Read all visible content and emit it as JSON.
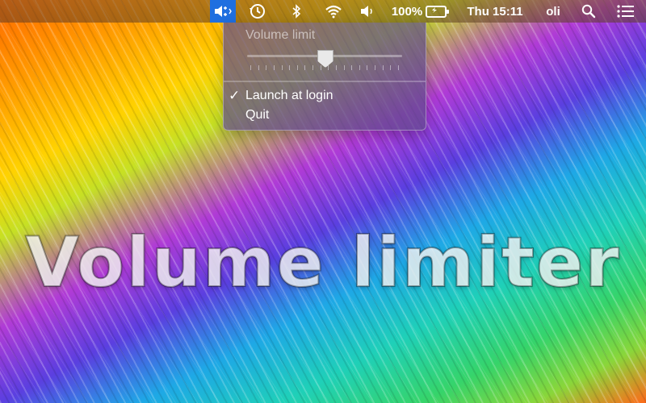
{
  "menubar": {
    "battery_percent": "100%",
    "datetime": "Thu 15:11",
    "user": "oli",
    "icons": [
      "volume-limiter-icon",
      "time-machine-icon",
      "bluetooth-icon",
      "wifi-icon",
      "volume-icon",
      "battery-icon",
      "search-icon",
      "notification-center-icon"
    ]
  },
  "dropdown": {
    "section_label": "Volume limit",
    "slider_value_fraction": 0.5,
    "items": [
      {
        "label": "Launch at login",
        "checked": true
      },
      {
        "label": "Quit",
        "checked": false
      }
    ]
  },
  "hero_text": "Volume limiter",
  "colors": {
    "menubar_active": "#1f6fe0",
    "dropdown_bg": "#5f4b8c"
  }
}
